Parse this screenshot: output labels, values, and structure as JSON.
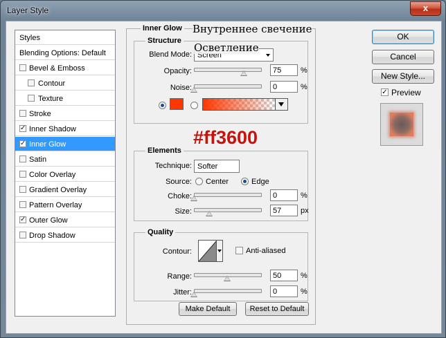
{
  "window": {
    "title": "Layer Style",
    "close_symbol": "x"
  },
  "styles_list": {
    "items": [
      {
        "label": "Styles",
        "checkbox": false,
        "indent": false,
        "checked": false,
        "selected": false,
        "kind": "header"
      },
      {
        "label": "Blending Options: Default",
        "checkbox": false,
        "indent": false,
        "checked": false,
        "selected": false,
        "kind": "header"
      },
      {
        "label": "Bevel & Emboss",
        "checkbox": true,
        "indent": false,
        "checked": false,
        "selected": false
      },
      {
        "label": "Contour",
        "checkbox": true,
        "indent": true,
        "checked": false,
        "selected": false
      },
      {
        "label": "Texture",
        "checkbox": true,
        "indent": true,
        "checked": false,
        "selected": false
      },
      {
        "label": "Stroke",
        "checkbox": true,
        "indent": false,
        "checked": false,
        "selected": false
      },
      {
        "label": "Inner Shadow",
        "checkbox": true,
        "indent": false,
        "checked": true,
        "selected": false
      },
      {
        "label": "Inner Glow",
        "checkbox": true,
        "indent": false,
        "checked": true,
        "selected": true
      },
      {
        "label": "Satin",
        "checkbox": true,
        "indent": false,
        "checked": false,
        "selected": false
      },
      {
        "label": "Color Overlay",
        "checkbox": true,
        "indent": false,
        "checked": false,
        "selected": false
      },
      {
        "label": "Gradient Overlay",
        "checkbox": true,
        "indent": false,
        "checked": false,
        "selected": false
      },
      {
        "label": "Pattern Overlay",
        "checkbox": true,
        "indent": false,
        "checked": false,
        "selected": false
      },
      {
        "label": "Outer Glow",
        "checkbox": true,
        "indent": false,
        "checked": true,
        "selected": false
      },
      {
        "label": "Drop Shadow",
        "checkbox": true,
        "indent": false,
        "checked": false,
        "selected": false
      }
    ]
  },
  "panel": {
    "title": "Inner Glow",
    "structure": {
      "title": "Structure",
      "blend_mode_label": "Blend Mode:",
      "blend_mode_value": "Screen",
      "opacity_label": "Opacity:",
      "opacity_value": "75",
      "opacity_level": 75,
      "opacity_unit": "%",
      "noise_label": "Noise:",
      "noise_value": "0",
      "noise_level": 0,
      "noise_unit": "%",
      "glow_color": "#ff3600"
    },
    "elements": {
      "title": "Elements",
      "technique_label": "Technique:",
      "technique_value": "Softer",
      "source_label": "Source:",
      "source_center": "Center",
      "source_edge": "Edge",
      "choke_label": "Choke:",
      "choke_value": "0",
      "choke_level": 0,
      "choke_unit": "%",
      "size_label": "Size:",
      "size_value": "57",
      "size_level": 23,
      "size_unit": "px"
    },
    "quality": {
      "title": "Quality",
      "contour_label": "Contour:",
      "anti_aliased_label": "Anti-aliased",
      "range_label": "Range:",
      "range_value": "50",
      "range_level": 50,
      "range_unit": "%",
      "jitter_label": "Jitter:",
      "jitter_value": "0",
      "jitter_level": 0,
      "jitter_unit": "%"
    },
    "make_default": "Make Default",
    "reset_default": "Reset to Default"
  },
  "buttons": {
    "ok": "OK",
    "cancel": "Cancel",
    "new_style": "New Style...",
    "preview_label": "Preview",
    "preview_checked": true
  },
  "annotations": {
    "inner_glow_ru": "Внутреннее свечение",
    "screen_ru": "Осветление",
    "hex": "#ff3600"
  },
  "colors": {
    "selection": "#3399ff",
    "swatch": "#ff3600",
    "annotation_red": "#c6140c"
  },
  "icons": [
    "close-icon",
    "checkbox-check-icon",
    "dropdown-arrow-icon",
    "contour-curve-icon",
    "gradient-swatch"
  ]
}
